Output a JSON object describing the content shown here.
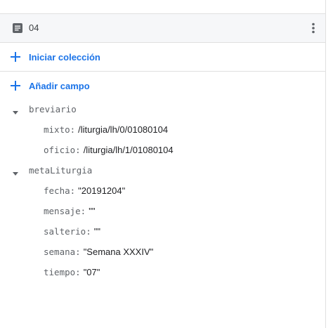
{
  "document": {
    "id": "04",
    "icon": "document-icon",
    "menu_icon": "more-vert-icon"
  },
  "actions": {
    "start_collection": "Iniciar colección",
    "add_field": "Añadir campo"
  },
  "fields": {
    "breviario": {
      "key": "breviario",
      "mixto": {
        "key": "mixto:",
        "value": "/liturgia/lh/0/01080104"
      },
      "oficio": {
        "key": "oficio:",
        "value": "/liturgia/lh/1/01080104"
      }
    },
    "metaLiturgia": {
      "key": "metaLiturgia",
      "fecha": {
        "key": "fecha:",
        "value": "\"20191204\""
      },
      "mensaje": {
        "key": "mensaje:",
        "value": "\"\""
      },
      "salterio": {
        "key": "salterio:",
        "value": "\"\""
      },
      "semana": {
        "key": "semana:",
        "value": "\"Semana XXXIV\""
      },
      "tiempo": {
        "key": "tiempo:",
        "value": "\"07\""
      }
    }
  },
  "colors": {
    "accent": "#1a73e8",
    "key_text": "#5f6368",
    "value_text": "#202124",
    "header_bg": "#f6f7f9",
    "divider": "#e0e0e0"
  }
}
